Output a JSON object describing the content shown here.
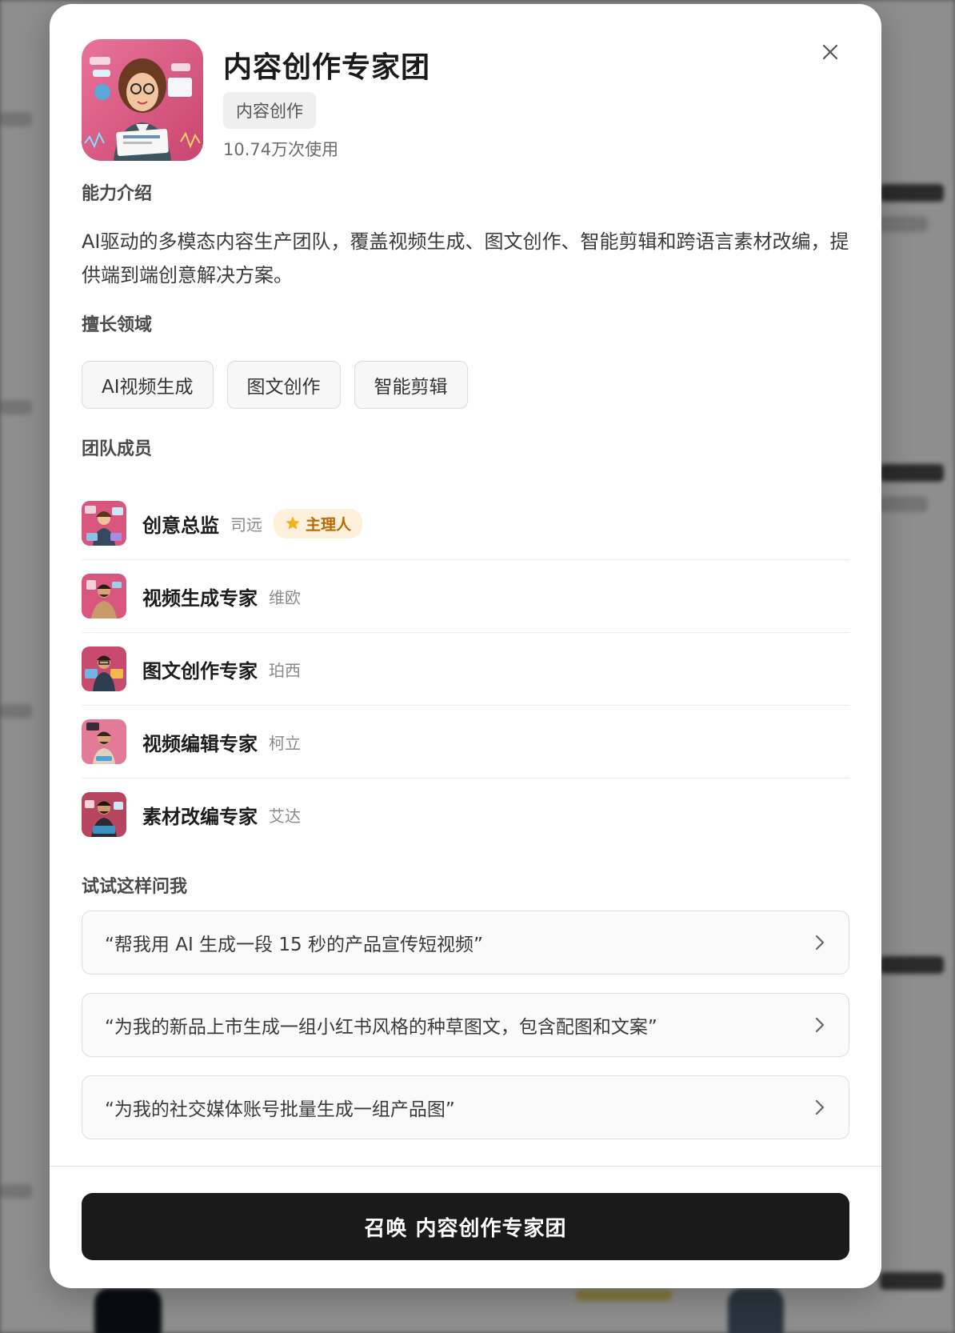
{
  "team": {
    "title": "内容创作专家团",
    "category": "内容创作",
    "usage": "10.74万次使用"
  },
  "sections": {
    "intro_label": "能力介绍",
    "intro_text": "AI驱动的多模态内容生产团队，覆盖视频生成、图文创作、智能剪辑和跨语言素材改编，提供端到端创意解决方案。",
    "domains_label": "擅长领域",
    "members_label": "团队成员",
    "prompts_label": "试试这样问我"
  },
  "domains": [
    "AI视频生成",
    "图文创作",
    "智能剪辑"
  ],
  "members": [
    {
      "role": "创意总监",
      "name": "司远",
      "badge": "主理人",
      "icon": "creative-director-avatar"
    },
    {
      "role": "视频生成专家",
      "name": "维欧",
      "icon": "video-generation-avatar"
    },
    {
      "role": "图文创作专家",
      "name": "珀西",
      "icon": "image-text-avatar"
    },
    {
      "role": "视频编辑专家",
      "name": "柯立",
      "icon": "video-editing-avatar"
    },
    {
      "role": "素材改编专家",
      "name": "艾达",
      "icon": "material-adaptation-avatar"
    }
  ],
  "prompts": [
    "“帮我用 AI 生成一段 15 秒的产品宣传短视频”",
    "“为我的新品上市生成一组小红书风格的种草图文，包含配图和文案”",
    "“为我的社交媒体账号批量生成一组产品图”"
  ],
  "footer": {
    "summon_label": "召唤 内容创作专家团"
  },
  "icons": {
    "close": "close-icon",
    "chevron": "chevron-right-icon",
    "star": "star-icon"
  },
  "colors": {
    "primary_button": "#1a1a1a",
    "badge_bg": "#fdf1dc",
    "badge_text": "#b86a00",
    "avatar_pink": "#d9567f"
  }
}
